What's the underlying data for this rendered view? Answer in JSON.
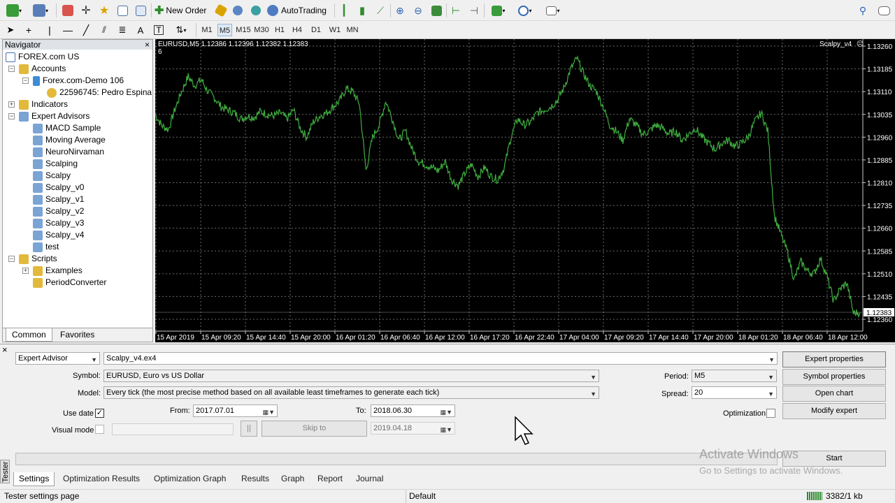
{
  "toolbar": {
    "new_order_label": "New Order",
    "autotrading_label": "AutoTrading",
    "timeframes": [
      "M1",
      "M5",
      "M15",
      "M30",
      "H1",
      "H4",
      "D1",
      "W1",
      "MN"
    ],
    "active_timeframe": "M5"
  },
  "navigator": {
    "title": "Navigator",
    "close": "×",
    "items": [
      {
        "label": "FOREX.com US"
      },
      {
        "label": "Accounts"
      },
      {
        "label": "Forex.com-Demo 106"
      },
      {
        "label": "22596745: Pedro Espina"
      },
      {
        "label": "Indicators"
      },
      {
        "label": "Expert Advisors"
      },
      {
        "label": "MACD Sample"
      },
      {
        "label": "Moving Average"
      },
      {
        "label": "NeuroNirvaman"
      },
      {
        "label": "Scalping"
      },
      {
        "label": "Scalpy"
      },
      {
        "label": "Scalpy_v0"
      },
      {
        "label": "Scalpy_v1"
      },
      {
        "label": "Scalpy_v2"
      },
      {
        "label": "Scalpy_v3"
      },
      {
        "label": "Scalpy_v4"
      },
      {
        "label": "test"
      },
      {
        "label": "Scripts"
      },
      {
        "label": "Examples"
      },
      {
        "label": "PeriodConverter"
      }
    ],
    "tabs": [
      "Common",
      "Favorites"
    ]
  },
  "chart": {
    "header": "EURUSD,M5  1.12386 1.12396 1.12382 1.12383",
    "header_sub": "6",
    "ea_label": "Scalpy_v4",
    "current_price": "1.12383",
    "price_labels": [
      "1.13260",
      "1.13185",
      "1.13110",
      "1.13035",
      "1.12960",
      "1.12885",
      "1.12810",
      "1.12735",
      "1.12660",
      "1.12585",
      "1.12510",
      "1.12435",
      "1.12360"
    ],
    "time_labels": [
      "15 Apr 2019",
      "15 Apr 09:20",
      "15 Apr 14:40",
      "15 Apr 20:00",
      "16 Apr 01:20",
      "16 Apr 06:40",
      "16 Apr 12:00",
      "16 Apr 17:20",
      "16 Apr 22:40",
      "17 Apr 04:00",
      "17 Apr 09:20",
      "17 Apr 14:40",
      "17 Apr 20:00",
      "18 Apr 01:20",
      "18 Apr 06:40",
      "18 Apr 12:00"
    ],
    "line_color": "#3fae3f",
    "price_series": [
      1.13035,
      1.12998,
      1.12985,
      1.13052,
      1.1311,
      1.1316,
      1.1313,
      1.1315,
      1.1311,
      1.1309,
      1.1306,
      1.1305,
      1.1304,
      1.1302,
      1.1303,
      1.13025,
      1.13045,
      1.13035,
      1.1303,
      1.1304,
      1.1302,
      1.1305,
      1.1299,
      1.1296,
      1.1301,
      1.1303,
      1.1304,
      1.1306,
      1.1308,
      1.1312,
      1.1311,
      1.1307,
      1.1285,
      1.1296,
      1.13,
      1.1308,
      1.1302,
      1.1295,
      1.1298,
      1.1292,
      1.1288,
      1.1287,
      1.1286,
      1.1285,
      1.1288,
      1.1282,
      1.128,
      1.1284,
      1.1287,
      1.1283,
      1.1286,
      1.1283,
      1.1282,
      1.1286,
      1.1296,
      1.1302,
      1.13,
      1.1301,
      1.1304,
      1.1305,
      1.1306,
      1.1308,
      1.1312,
      1.1318,
      1.1322,
      1.1317,
      1.1313,
      1.1311,
      1.1306,
      1.13,
      1.1298,
      1.1295,
      1.1302,
      1.13,
      1.1297,
      1.1298,
      1.13,
      1.1299,
      1.1297,
      1.1298,
      1.1295,
      1.1297,
      1.1299,
      1.1296,
      1.1294,
      1.1292,
      1.1294,
      1.1295,
      1.1293,
      1.1294,
      1.1296,
      1.1301,
      1.1304,
      1.1298,
      1.127,
      1.1264,
      1.1258,
      1.1249,
      1.1255,
      1.1252,
      1.1251,
      1.1256,
      1.125,
      1.1242,
      1.1246,
      1.1248,
      1.1238,
      1.12383
    ]
  },
  "tester": {
    "close": "×",
    "side_label": "Tester",
    "ea_type": "Expert Advisor",
    "ea_file": "Scalpy_v4.ex4",
    "symbol_label": "Symbol:",
    "symbol_value": "EURUSD, Euro vs US Dollar",
    "model_label": "Model:",
    "model_value": "Every tick (the most precise method based on all available least timeframes to generate each tick)",
    "use_date_label": "Use date",
    "use_date_checked": "✓",
    "from_label": "From:",
    "from_value": "2017.07.01",
    "to_label": "To:",
    "to_value": "2018.06.30",
    "visual_mode_label": "Visual mode",
    "pause_label": "||",
    "skip_to_label": "Skip to",
    "skip_date": "2019.04.18",
    "period_label": "Period:",
    "period_value": "M5",
    "spread_label": "Spread:",
    "spread_value": "20",
    "optimization_label": "Optimization",
    "buttons": {
      "expert_properties": "Expert properties",
      "symbol_properties": "Symbol properties",
      "open_chart": "Open chart",
      "modify_expert": "Modify expert",
      "start": "Start"
    },
    "tabs": [
      "Settings",
      "Optimization Results",
      "Optimization Graph",
      "Results",
      "Graph",
      "Report",
      "Journal"
    ]
  },
  "watermark": {
    "line1": "Activate Windows",
    "line2": "Go to Settings to activate Windows."
  },
  "status": {
    "left": "Tester settings page",
    "profile": "Default",
    "traffic": "3382/1 kb"
  }
}
